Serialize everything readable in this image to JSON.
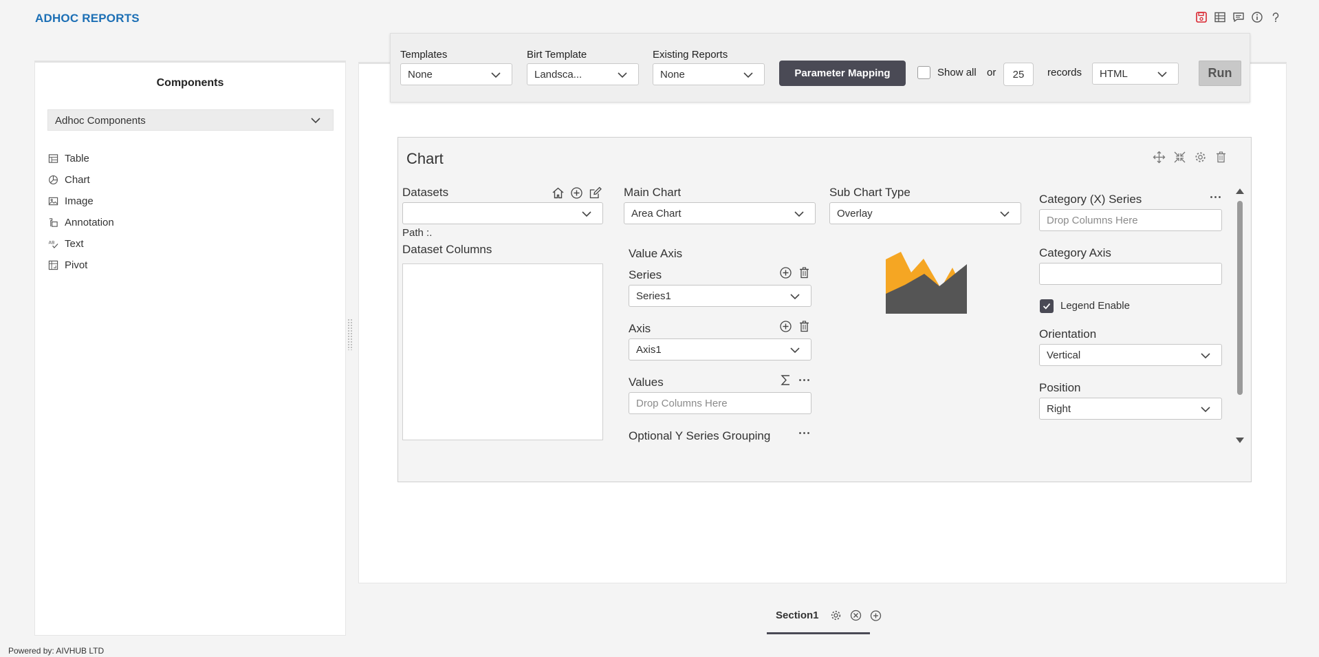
{
  "app": {
    "title": "ADHOC REPORTS",
    "powered_by": "Powered by: AIVHUB LTD"
  },
  "header_icons": [
    "save-icon",
    "table-icon",
    "comment-icon",
    "info-icon",
    "help-icon"
  ],
  "colors": {
    "accent_blue": "#1c6fb5",
    "dark_button": "#4a4a55",
    "chart_orange": "#f5a623",
    "chart_gray": "#555555",
    "save_red": "#d9252f"
  },
  "components": {
    "title": "Components",
    "selector": "Adhoc Components",
    "items": [
      {
        "label": "Table",
        "icon": "table-icon"
      },
      {
        "label": "Chart",
        "icon": "chart-icon"
      },
      {
        "label": "Image",
        "icon": "image-icon"
      },
      {
        "label": "Annotation",
        "icon": "annotation-icon"
      },
      {
        "label": "Text",
        "icon": "text-icon"
      },
      {
        "label": "Pivot",
        "icon": "pivot-icon"
      }
    ]
  },
  "toolbar": {
    "templates_label": "Templates",
    "templates_value": "None",
    "birt_label": "Birt Template",
    "birt_value": "Landsca...",
    "existing_label": "Existing Reports",
    "existing_value": "None",
    "param_button": "Parameter Mapping",
    "show_all_label": "Show all",
    "or_label": "or",
    "records_count": "25",
    "records_label": "records",
    "format_value": "HTML",
    "run_button": "Run"
  },
  "chart": {
    "title": "Chart",
    "datasets_label": "Datasets",
    "path_label": "Path :.",
    "dataset_columns_label": "Dataset Columns",
    "main_chart_label": "Main Chart",
    "main_chart_value": "Area Chart",
    "value_axis_label": "Value Axis",
    "series_label": "Series",
    "series_value": "Series1",
    "axis_label": "Axis",
    "axis_value": "Axis1",
    "values_label": "Values",
    "values_placeholder": "Drop Columns Here",
    "optional_y_label": "Optional Y Series Grouping",
    "sub_chart_label": "Sub Chart Type",
    "sub_chart_value": "Overlay",
    "category_x_label": "Category (X) Series",
    "category_x_placeholder": "Drop Columns Here",
    "category_axis_label": "Category Axis",
    "category_axis_value": "",
    "legend_label": "Legend Enable",
    "orientation_label": "Orientation",
    "orientation_value": "Vertical",
    "position_label": "Position",
    "position_value": "Right"
  },
  "section": {
    "label": "Section1"
  }
}
